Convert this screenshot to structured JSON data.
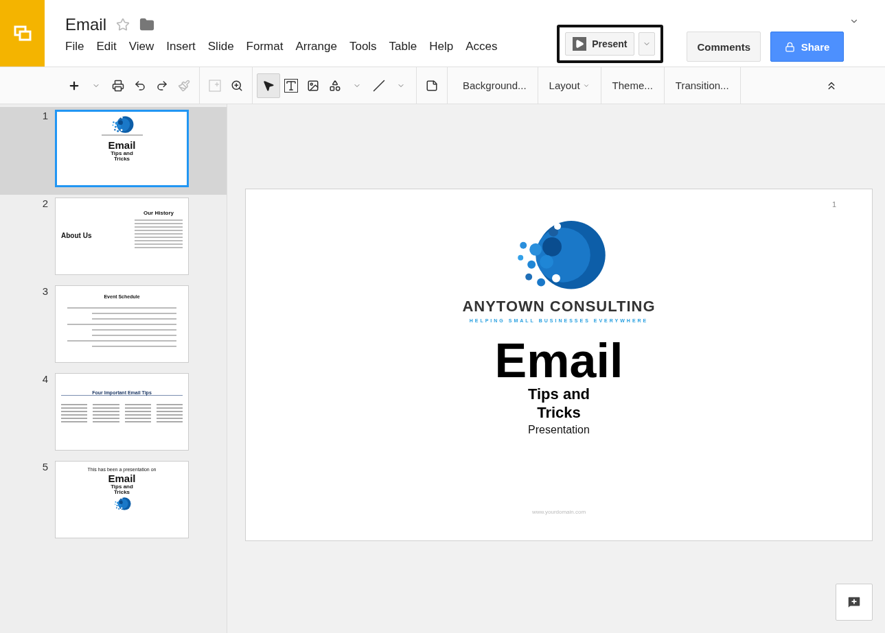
{
  "document": {
    "title": "Email",
    "starred": false
  },
  "menu": [
    "File",
    "Edit",
    "View",
    "Insert",
    "Slide",
    "Format",
    "Arrange",
    "Tools",
    "Table",
    "Help",
    "Acces"
  ],
  "present": {
    "label": "Present",
    "highlighted": true
  },
  "comments": {
    "label": "Comments"
  },
  "share": {
    "label": "Share"
  },
  "toolbar": {
    "text_buttons": [
      {
        "label": "Background...",
        "dropdown": false
      },
      {
        "label": "Layout",
        "dropdown": true
      },
      {
        "label": "Theme...",
        "dropdown": false
      },
      {
        "label": "Transition...",
        "dropdown": false
      }
    ]
  },
  "slides": [
    {
      "number": "1",
      "selected": true,
      "kind": "title",
      "title": "Email",
      "subtitle": "Tips and Tricks"
    },
    {
      "number": "2",
      "selected": false,
      "kind": "about",
      "heading": "Our History",
      "title": "About Us"
    },
    {
      "number": "3",
      "selected": false,
      "kind": "schedule",
      "heading": "Event Schedule"
    },
    {
      "number": "4",
      "selected": false,
      "kind": "tips",
      "heading": "Four Important Email Tips"
    },
    {
      "number": "5",
      "selected": false,
      "kind": "closing",
      "intro": "This has been a presentation on",
      "title": "Email",
      "subtitle": "Tips and Tricks"
    }
  ],
  "current_slide": {
    "page_number": "1",
    "company": "ANYTOWN CONSULTING",
    "tagline": "HELPING SMALL BUSINESSES EVERYWHERE",
    "title": "Email",
    "subtitle_lines": [
      "Tips and",
      "Tricks"
    ],
    "caption": "Presentation",
    "footer": "www.yourdomain.com"
  }
}
